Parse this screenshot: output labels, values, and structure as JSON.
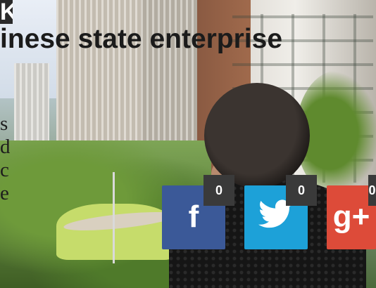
{
  "article": {
    "title": "inese state enterprise",
    "corner_glyph": "K",
    "side_text_fragments": [
      "s",
      "d",
      "c",
      "e"
    ]
  },
  "share": {
    "facebook": {
      "glyph": "f",
      "count": "0",
      "icon": "facebook-icon",
      "color": "#3b5998"
    },
    "twitter": {
      "count": "0",
      "icon": "twitter-bird-icon",
      "color": "#1da1d8"
    },
    "googleplus": {
      "glyph": "g+",
      "count": "0",
      "icon": "google-plus-icon",
      "color": "#dd4b39"
    }
  }
}
